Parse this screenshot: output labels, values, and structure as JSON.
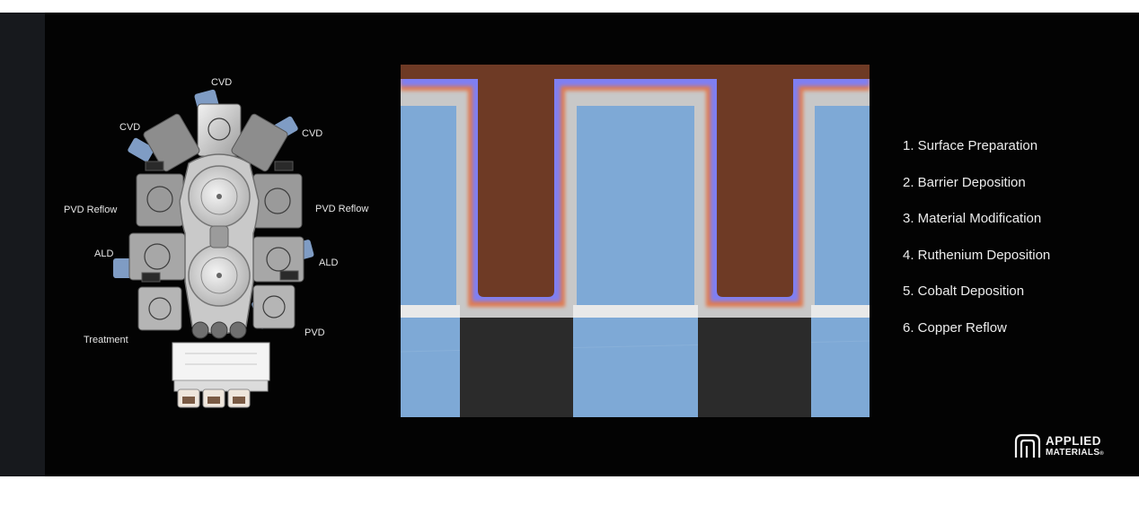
{
  "tool_labels": {
    "cvd_top": "CVD",
    "cvd_left": "CVD",
    "cvd_right": "CVD",
    "pvd_reflow_left": "PVD Reflow",
    "pvd_reflow_right": "PVD Reflow",
    "ald_left": "ALD",
    "ald_right": "ALD",
    "treatment": "Treatment",
    "pvd": "PVD"
  },
  "steps": [
    "1. Surface Preparation",
    "2. Barrier Deposition",
    "3. Material Modification",
    "4. Ruthenium Deposition",
    "5. Cobalt Deposition",
    "6. Copper Reflow"
  ],
  "logo": {
    "line1": "APPLIED",
    "line2": "MATERIALS",
    "mark": "®"
  },
  "colors": {
    "background": "#030303",
    "dielectric": "#7ea9d6",
    "copper": "#6e3a25",
    "barrier": "#c8c8c8",
    "cobalt_glow": "#7f7ff2",
    "ruthenium_glow": "#e07a50"
  }
}
